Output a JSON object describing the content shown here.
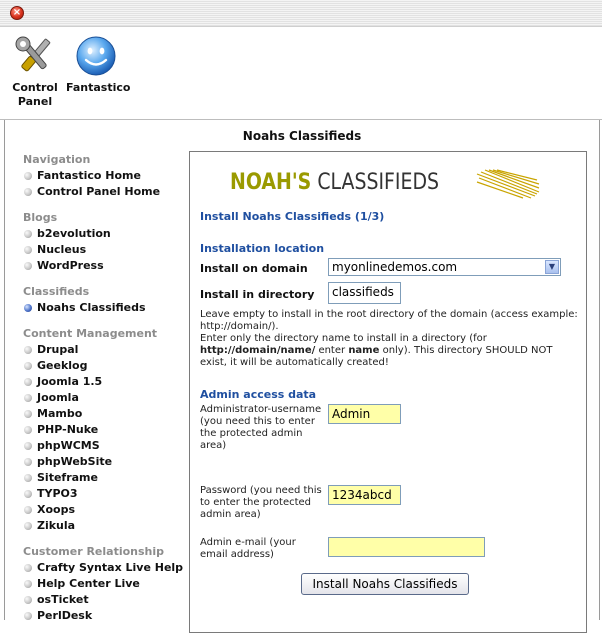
{
  "toolbar": {
    "control_panel_label_1": "Control",
    "control_panel_label_2": "Panel",
    "fantastico_label": "Fantastico"
  },
  "page": {
    "title": "Noahs Classifieds"
  },
  "sidebar": {
    "groups": [
      {
        "heading": "Navigation",
        "items": [
          "Fantastico Home",
          "Control Panel Home"
        ]
      },
      {
        "heading": "Blogs",
        "items": [
          "b2evolution",
          "Nucleus",
          "WordPress"
        ]
      },
      {
        "heading": "Classifieds",
        "items": [
          "Noahs Classifieds"
        ]
      },
      {
        "heading": "Content Management",
        "items": [
          "Drupal",
          "Geeklog",
          "Joomla 1.5",
          "Joomla",
          "Mambo",
          "PHP-Nuke",
          "phpWCMS",
          "phpWebSite",
          "Siteframe",
          "TYPO3",
          "Xoops",
          "Zikula"
        ]
      },
      {
        "heading": "Customer Relationship",
        "items": [
          "Crafty Syntax Live Help",
          "Help Center Live",
          "osTicket",
          "PerlDesk"
        ]
      }
    ]
  },
  "main": {
    "logo_part1": "NOAH'S",
    "logo_part2": " CLASSIFIEDS",
    "step_title": "Install Noahs Classifieds (1/3)",
    "section_location": "Installation location",
    "domain_label": "Install on domain",
    "domain_value": "myonlinedemos.com",
    "directory_label": "Install in directory",
    "directory_value": "classifieds",
    "help_line1": "Leave empty to install in the root directory of the domain (access example: http://domain/).",
    "help_line2": "Enter only the directory name to install in a directory (for",
    "help_bold1": "http://domain/name/",
    "help_mid": " enter ",
    "help_bold2": "name",
    "help_line3": " only). This directory SHOULD NOT exist, it will be automatically created!",
    "section_admin": "Admin access data",
    "admin_user_label": "Administrator-username (you need this to enter the protected admin area)",
    "admin_user_value": "Admin",
    "password_label": "Password (you need this to enter the protected admin area)",
    "password_value": "1234abcd",
    "email_label": "Admin e-mail (your email address)",
    "email_value": "",
    "submit_label": "Install Noahs Classifieds"
  },
  "colors": {
    "heading_blue": "#1f4fa0",
    "logo_olive": "#9a9a00",
    "input_highlight": "#ffffa8",
    "sidebar_heading_gray": "#8c8c8c"
  }
}
